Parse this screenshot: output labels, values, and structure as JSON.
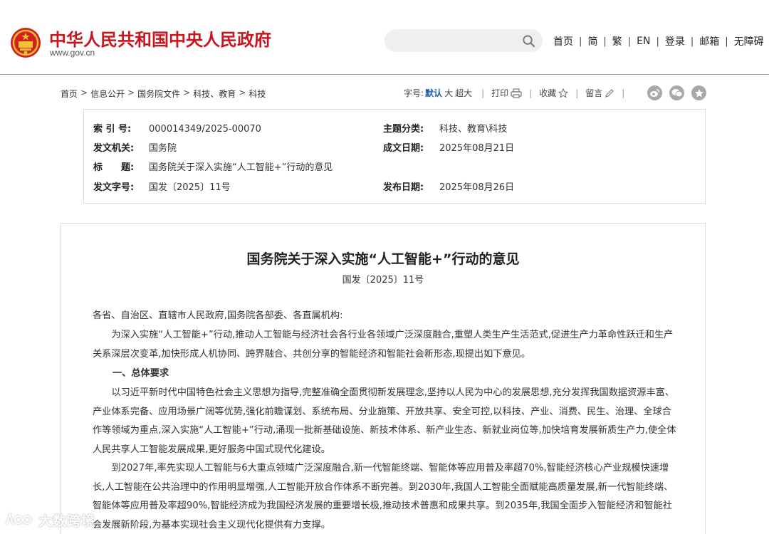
{
  "header": {
    "site_title": "中华人民共和国中央人民政府",
    "site_url": "www.gov.cn",
    "search_placeholder": "",
    "nav": [
      "首页",
      "简",
      "繁",
      "EN",
      "登录",
      "邮箱",
      "无障碍"
    ],
    "brand_color": "#c8161e"
  },
  "breadcrumb": [
    "首页",
    "信息公开",
    "国务院文件",
    "科技、教育",
    "科技"
  ],
  "tools": {
    "font_label": "字号:",
    "size_default": "默认",
    "size_large": "大",
    "size_xlarge": "超大",
    "print": "打印",
    "favorite": "收藏",
    "comment": "留言"
  },
  "meta": {
    "index_label": "索 引 号:",
    "index_value": "000014349/2025-00070",
    "topic_label": "主题分类:",
    "topic_value": "科技、教育\\科技",
    "issuer_label": "发文机关:",
    "issuer_value": "国务院",
    "written_label": "成文日期:",
    "written_value": "2025年08月21日",
    "title_label": "标　　题:",
    "title_value": "国务院关于深入实施“人工智能+”行动的意见",
    "docno_label": "发文字号:",
    "docno_value": "国发〔2025〕11号",
    "published_label": "发布日期:",
    "published_value": "2025年08月26日"
  },
  "article": {
    "title": "国务院关于深入实施“人工智能+”行动的意见",
    "doc_number": "国发〔2025〕11号",
    "salutation": "各省、自治区、直辖市人民政府,国务院各部委、各直属机构:",
    "para1": "为深入实施“人工智能+”行动,推动人工智能与经济社会各行业各领域广泛深度融合,重塑人类生产生活范式,促进生产力革命性跃迁和生产关系深层次变革,加快形成人机协同、跨界融合、共创分享的智能经济和智能社会新形态,现提出如下意见。",
    "heading1": "一、总体要求",
    "para2": "以习近平新时代中国特色社会主义思想为指导,完整准确全面贯彻新发展理念,坚持以人民为中心的发展思想,充分发挥我国数据资源丰富、产业体系完备、应用场景广阔等优势,强化前瞻谋划、系统布局、分业施策、开放共享、安全可控,以科技、产业、消费、民生、治理、全球合作等领域为重点,深入实施“人工智能+”行动,涌现一批新基础设施、新技术体系、新产业生态、新就业岗位等,加快培育发展新质生产力,使全体人民共享人工智能发展成果,更好服务中国式现代化建设。",
    "para3": "到2027年,率先实现人工智能与6大重点领域广泛深度融合,新一代智能终端、智能体等应用普及率超70%,智能经济核心产业规模快速增长,人工智能在公共治理中的作用明显增强,人工智能开放合作体系不断完善。到2030年,我国人工智能全面赋能高质量发展,新一代智能终端、智能体等应用普及率超90%,智能经济成为我国经济发展的重要增长极,推动技术普惠和成果共享。到2035年,我国全面步入智能经济和智能社会发展新阶段,为基本实现社会主义现代化提供有力支撑。"
  },
  "watermark": {
    "text": "大数跨境"
  }
}
